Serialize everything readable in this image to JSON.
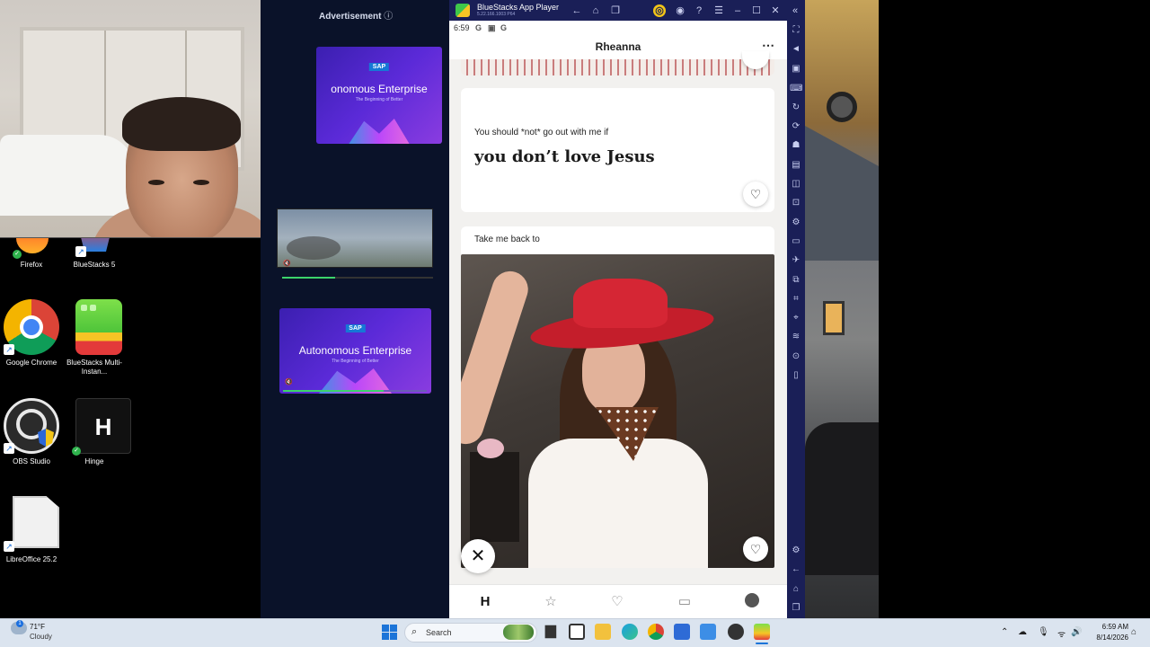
{
  "desktop": {
    "icons": [
      {
        "label": "Firefox"
      },
      {
        "label": "BlueStacks 5"
      },
      {
        "label": "Google Chrome"
      },
      {
        "label": "BlueStacks Multi-Instan..."
      },
      {
        "label": "OBS Studio"
      },
      {
        "label": "Hinge"
      },
      {
        "label": "LibreOffice 25.2"
      }
    ]
  },
  "ads": {
    "label": "Advertisement",
    "info_icon": "info-icon",
    "brand": "SAP",
    "top_card_title": "onomous Enterprise",
    "bottom_card_title": "Autonomous Enterprise",
    "tagline": "The Beginning of Better",
    "video_progress": 0.35,
    "bottom_progress": 0.7
  },
  "bluestacks": {
    "title": "BlueStacks App Player",
    "version": "5.22.166.1003 P64",
    "accent": "#1a1f57"
  },
  "android": {
    "time": "6:59",
    "status_icons": [
      "G",
      "▣",
      "G"
    ]
  },
  "hinge": {
    "profile_name": "Rheanna",
    "more_icon": "⋯",
    "prompt": {
      "question": "You should *not* go out with me if",
      "answer": "you don’t love Jesus"
    },
    "photo_prompt": "Take me back to",
    "nav": [
      "hinge-logo-icon",
      "star-icon",
      "heart-icon",
      "chat-icon",
      "profile-icon"
    ]
  },
  "taskbar": {
    "weather_temp": "71°F",
    "weather_cond": "Cloudy",
    "weather_badge": "1",
    "search_label": "Search",
    "clock_time": "6:59 AM",
    "clock_date": "8/14/2026"
  }
}
